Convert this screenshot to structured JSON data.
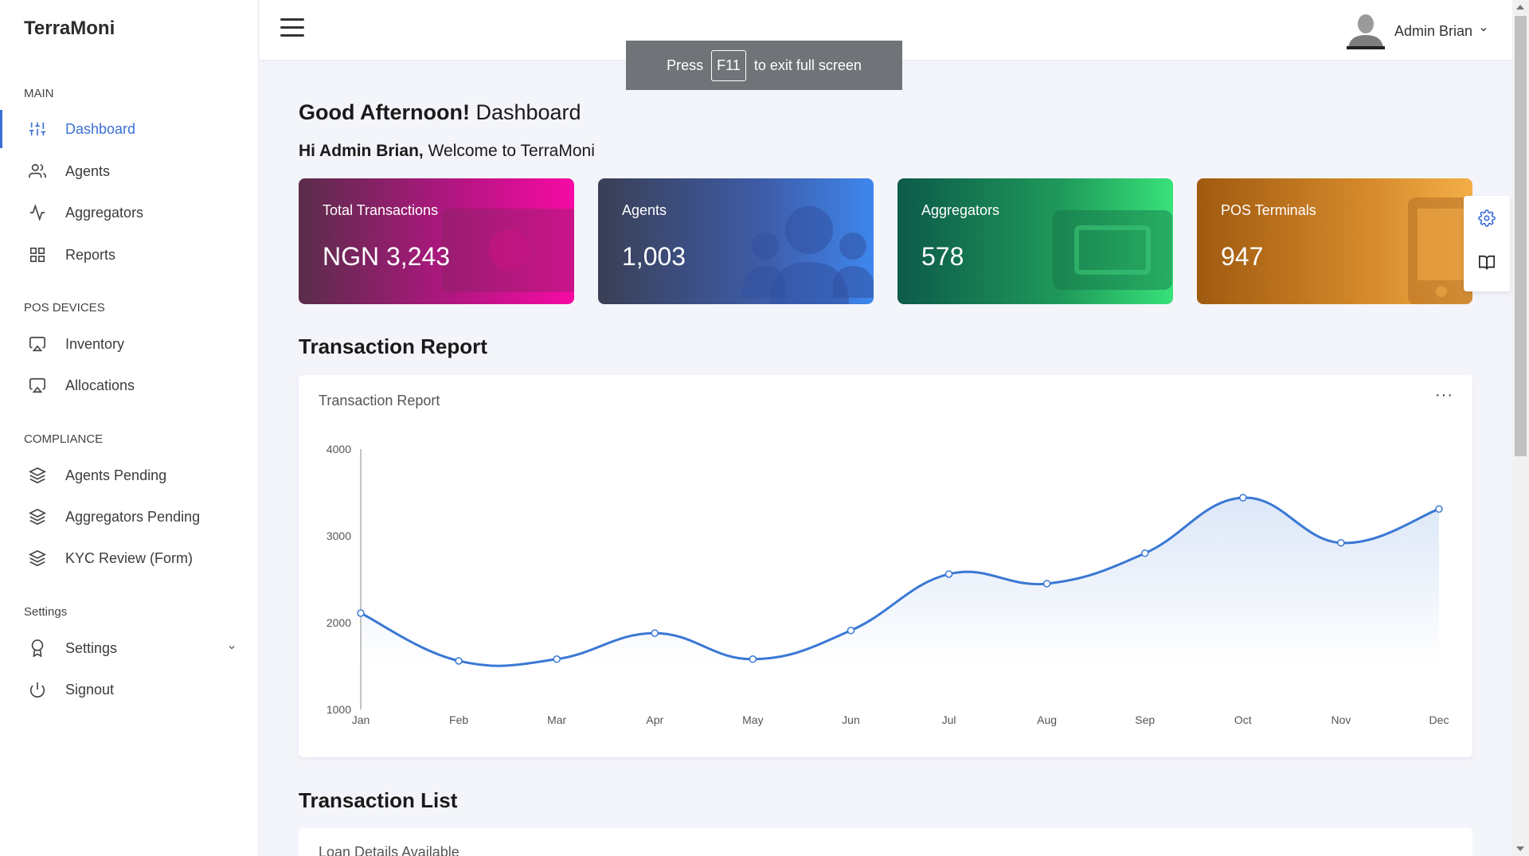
{
  "brand": "TerraMoni",
  "sidebar": {
    "sections": [
      {
        "label": "MAIN"
      },
      {
        "label": "POS DEVICES"
      },
      {
        "label": "COMPLIANCE"
      },
      {
        "label": "Settings"
      }
    ],
    "items": [
      {
        "label": "Dashboard",
        "icon": "sliders-icon",
        "active": true
      },
      {
        "label": "Agents",
        "icon": "users-icon"
      },
      {
        "label": "Aggregators",
        "icon": "activity-icon"
      },
      {
        "label": "Reports",
        "icon": "grid-icon"
      },
      {
        "label": "Inventory",
        "icon": "airplay-icon"
      },
      {
        "label": "Allocations",
        "icon": "airplay-icon"
      },
      {
        "label": "Agents Pending",
        "icon": "layers-icon"
      },
      {
        "label": "Aggregators Pending",
        "icon": "layers-icon"
      },
      {
        "label": "KYC Review (Form)",
        "icon": "layers-icon"
      },
      {
        "label": "Settings",
        "icon": "award-icon"
      },
      {
        "label": "Signout",
        "icon": "power-icon"
      }
    ]
  },
  "topbar": {
    "user_name": "Admin Brian"
  },
  "fullscreen_toast": {
    "press": "Press",
    "key": "F11",
    "rest": "to exit full screen"
  },
  "greeting": {
    "bold": "Good Afternoon!",
    "rest": "Dashboard",
    "sub_bold": "Hi Admin Brian,",
    "sub_rest": "Welcome to TerraMoni"
  },
  "cards": [
    {
      "title": "Total Transactions",
      "value": "NGN 3,243",
      "icon": "money-icon"
    },
    {
      "title": "Agents",
      "value": "1,003",
      "icon": "users-icon"
    },
    {
      "title": "Aggregators",
      "value": "578",
      "icon": "ticket-icon"
    },
    {
      "title": "POS Terminals",
      "value": "947",
      "icon": "tablet-icon"
    }
  ],
  "sections": {
    "report_heading": "Transaction Report",
    "list_heading": "Transaction List"
  },
  "report_panel": {
    "title": "Transaction Report",
    "more": "···"
  },
  "list_panel": {
    "title": "Loan Details Available"
  },
  "colors": {
    "accent": "#3b6fd6",
    "line": "#3a78d4"
  },
  "chart_data": {
    "type": "area",
    "title": "Transaction Report",
    "categories": [
      "Jan",
      "Feb",
      "Mar",
      "Apr",
      "May",
      "Jun",
      "Jul",
      "Aug",
      "Sep",
      "Oct",
      "Nov",
      "Dec"
    ],
    "series": [
      {
        "values": [
          2110,
          1560,
          1580,
          1880,
          1580,
          1910,
          2560,
          2450,
          2800,
          3440,
          2920,
          3310
        ]
      }
    ],
    "ylim": [
      1000,
      4000
    ],
    "yticks": [
      "1000",
      "2000",
      "3000",
      "4000"
    ],
    "grid": false,
    "xlabel": "",
    "ylabel": ""
  }
}
